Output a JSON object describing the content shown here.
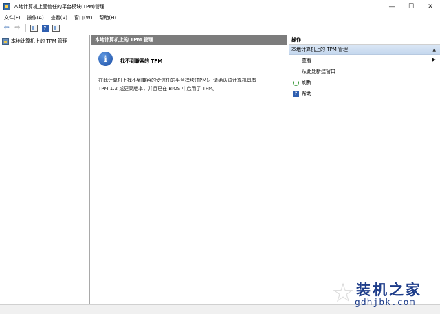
{
  "window": {
    "title": "本地计算机上受信任的平台模块(TPM)管理",
    "minimize_glyph": "—",
    "maximize_glyph": "☐",
    "close_glyph": "✕"
  },
  "menubar": {
    "items": [
      "文件(F)",
      "操作(A)",
      "查看(V)",
      "窗口(W)",
      "帮助(H)"
    ]
  },
  "toolbar": {
    "back_glyph": "⇦",
    "forward_glyph": "⇨",
    "help_glyph": "?"
  },
  "left_pane": {
    "tree_item": "本地计算机上的 TPM 管理"
  },
  "center_pane": {
    "header": "本地计算机上的 TPM 管理",
    "info_glyph": "i",
    "message_title": "找不到兼容的 TPM",
    "message_body_line1": "在此计算机上找不到兼容的受信任的平台模块(TPM)。请确认该计算机具有",
    "message_body_line2": "TPM 1.2 或更高版本，并且已在 BIOS 中启用了 TPM。"
  },
  "right_pane": {
    "header": "操作",
    "section_title": "本地计算机上的 TPM 管理",
    "section_caret": "▲",
    "actions": [
      {
        "label": "查看",
        "has_submenu": true
      },
      {
        "label": "从此处新建窗口"
      },
      {
        "label": "刷新",
        "icon": "refresh-icon"
      },
      {
        "label": "帮助",
        "icon": "help-icon"
      }
    ],
    "submenu_glyph": "▶",
    "help_glyph": "?"
  },
  "watermark": {
    "star_glyph": "☆",
    "title": "装机之家",
    "url": "gdhjbk.com"
  }
}
